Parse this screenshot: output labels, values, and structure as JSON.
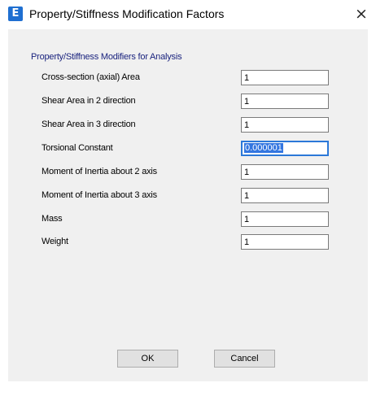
{
  "window": {
    "title": "Property/Stiffness Modification Factors",
    "app_icon_letter": "E",
    "close_glyph": "×"
  },
  "group": {
    "label": "Property/Stiffness Modifiers for Analysis"
  },
  "fields": [
    {
      "label": "Cross-section (axial) Area",
      "value": "1"
    },
    {
      "label": "Shear Area in 2 direction",
      "value": "1"
    },
    {
      "label": "Shear Area in 3 direction",
      "value": "1"
    },
    {
      "label": "Torsional Constant",
      "value": "0.000001"
    },
    {
      "label": "Moment of Inertia about 2 axis",
      "value": "1"
    },
    {
      "label": "Moment of Inertia about 3 axis",
      "value": "1"
    },
    {
      "label": "Mass",
      "value": "1"
    },
    {
      "label": "Weight",
      "value": "1"
    }
  ],
  "buttons": {
    "ok": "OK",
    "cancel": "Cancel"
  },
  "colors": {
    "accent": "#1f6fd1",
    "group_label": "#1a237e",
    "selection": "#3376e0"
  },
  "icons": {
    "app": "etabs-e-icon",
    "close": "close-icon"
  }
}
